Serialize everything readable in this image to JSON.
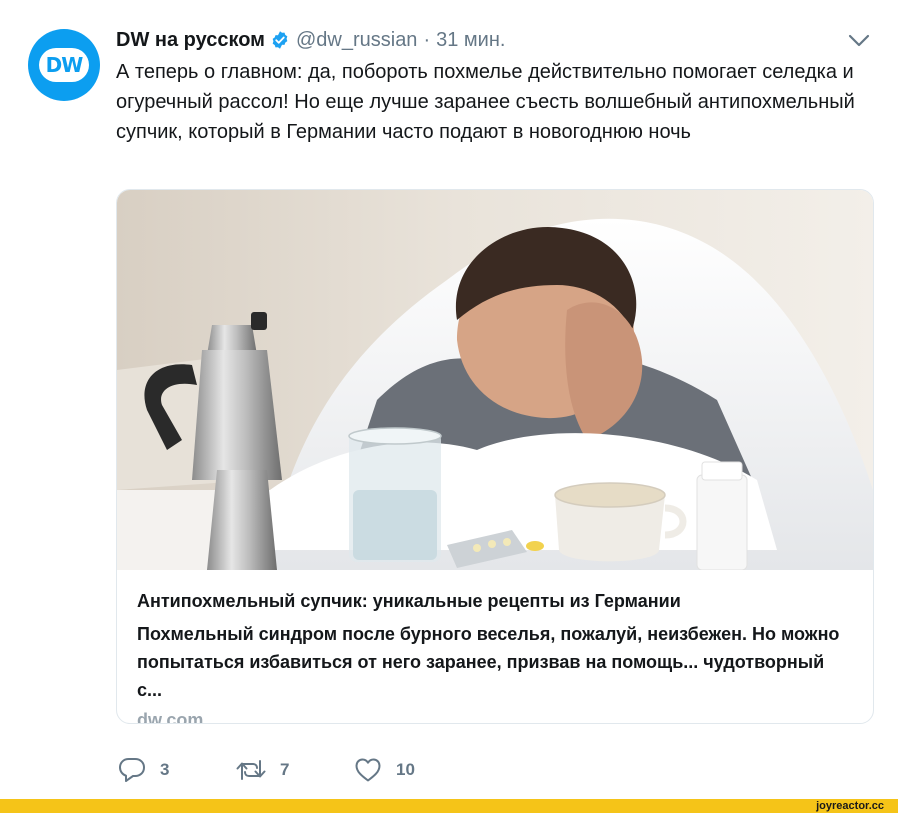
{
  "tweet": {
    "author_name": "DW на русском",
    "handle": "@dw_russian",
    "separator": "·",
    "time": "31 мин.",
    "avatar_text": "DW",
    "text": "А теперь о главном: да, побороть похмелье действительно помогает селедка и огуречный рассол! Но еще лучше заранее съесть волшебный антипохмельный супчик, который в Германии часто подают в новогоднюю ночь"
  },
  "card": {
    "title": "Антипохмельный супчик: уникальные рецепты из Германии",
    "description": "Похмельный синдром после бурного веселья, пожалуй, неизбежен. Но можно попытаться избавиться от него заранее, призвав на помощь... чудотворный с...",
    "domain": "dw.com"
  },
  "actions": {
    "replies": "3",
    "retweets": "7",
    "likes": "10"
  },
  "footer": {
    "watermark": "joyreactor.cc"
  },
  "icons": {
    "verified": "verified-badge-icon",
    "caret": "chevron-down-icon",
    "reply": "reply-icon",
    "retweet": "retweet-icon",
    "like": "heart-icon"
  },
  "colors": {
    "accent": "#1da1f2",
    "dw_blue": "#0c9ef0",
    "muted": "#657786",
    "watermark_bar": "#f5c418"
  }
}
